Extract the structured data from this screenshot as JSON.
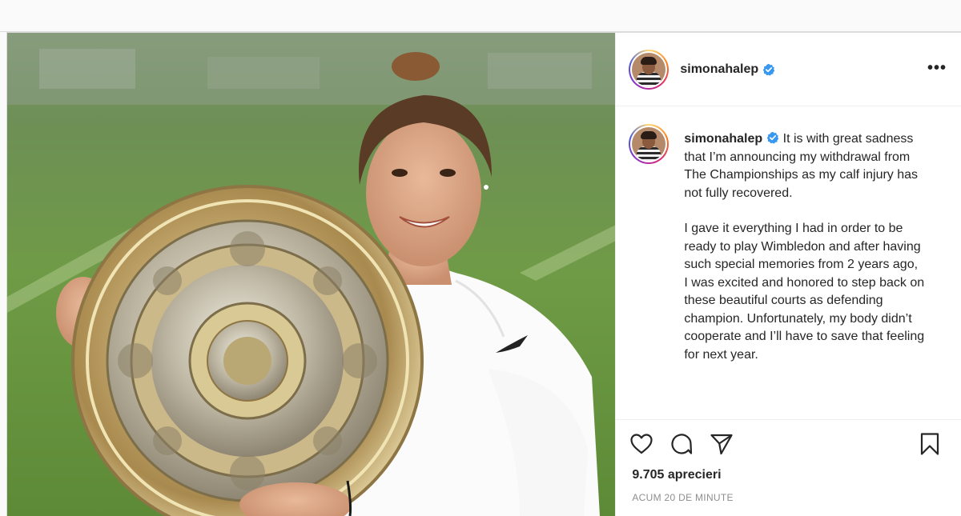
{
  "post": {
    "username": "simonahalep",
    "verified": true,
    "caption_paragraphs": [
      "It is with great sadness that I’m announcing my withdrawal from The Championships as my calf injury has not fully recovered.",
      "I gave it everything I had in order to be ready to play Wimbledon and after having such special memories from 2 years ago, I was excited and honored to step back on these beautiful courts as defending champion. Unfortunately, my body didn’t cooperate and I’ll have to save that feeling for next year."
    ],
    "likes": "9.705 aprecieri",
    "timestamp": "ACUM 20 DE MINUTE"
  },
  "icons": {
    "verified": "verified-badge-icon",
    "more": "more-options-icon",
    "like": "heart-icon",
    "comment": "comment-icon",
    "share": "paper-plane-icon",
    "save": "bookmark-icon"
  },
  "colors": {
    "verified_blue": "#3897f0",
    "text": "#262626",
    "muted": "#8e8e8e",
    "border": "#dbdbdb"
  }
}
